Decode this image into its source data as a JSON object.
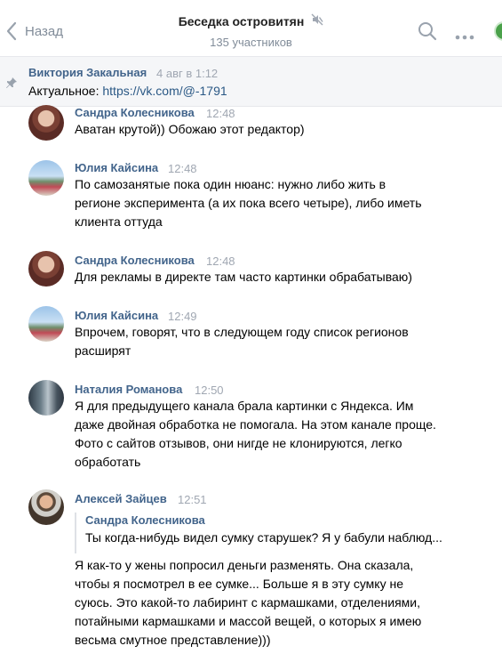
{
  "header": {
    "back_label": "Назад",
    "title": "Беседка островитян",
    "subtitle": "135 участников",
    "icons": [
      "chevron-left-icon",
      "mute-icon",
      "search-icon",
      "more-icon"
    ]
  },
  "pinned": {
    "author": "Виктория Закальная",
    "time": "4 авг в 1:12",
    "prefix": "Актуальное: ",
    "link": "https://vk.com/@-1791",
    "icon": "pin-icon"
  },
  "colors": {
    "accent": "#42648b",
    "link": "#2a5885",
    "muted": "#818c99",
    "time": "#a0a7b2",
    "pinned_bg": "#f5f6f8"
  },
  "messages": [
    {
      "author": "Сандра Колесникова",
      "time": "12:48",
      "lines": [
        "Аватан крутой)) Обожаю этот редактор)"
      ]
    },
    {
      "author": "Юлия Кайсина",
      "time": "12:48",
      "lines": [
        "По самозанятые пока один нюанс: нужно либо жить в",
        "регионе эксперимента (а их пока всего четыре), либо иметь",
        "клиента оттуда"
      ]
    },
    {
      "author": "Сандра Колесникова",
      "time": "12:48",
      "lines": [
        "Для рекламы в директе там часто картинки обрабатываю)"
      ]
    },
    {
      "author": "Юлия Кайсина",
      "time": "12:49",
      "lines": [
        "Впрочем, говорят, что в следующем году список регионов",
        "расширят"
      ]
    },
    {
      "author": "Наталия Романова",
      "time": "12:50",
      "lines": [
        "Я для предыдущего канала брала картинки с Яндекса. Им",
        "даже двойная обработка не помогала. На этом канале проще.",
        "Фото с сайтов отзывов, они нигде не клонируются, легко",
        "обработать"
      ]
    },
    {
      "author": "Алексей Зайцев",
      "time": "12:51",
      "quote": {
        "author": "Сандра Колесникова",
        "text": "Ты когда-нибудь видел сумку старушек? Я у бабули наблюд..."
      },
      "lines": [
        "Я как-то у жены попросил деньги разменять. Она сказала,",
        "чтобы я посмотрел в ее сумке... Больше я в эту сумку не",
        "суюсь. Это какой-то лабиринт с кармашками, отделениями,",
        "потайными кармашками и массой вещей, о которых я имею",
        "весьма смутное представление)))"
      ]
    }
  ]
}
